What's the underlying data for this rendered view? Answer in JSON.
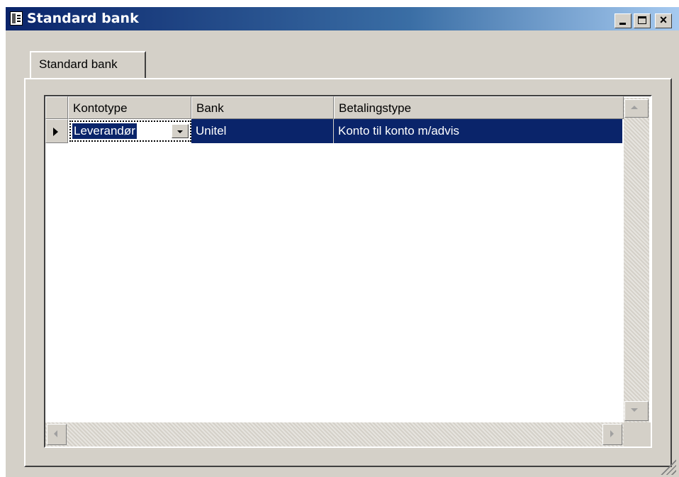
{
  "window": {
    "title": "Standard bank",
    "icon": "form-icon",
    "caption_buttons": [
      "minimize-icon",
      "maximize-icon",
      "close-icon"
    ],
    "close_glyph": "×"
  },
  "tab": {
    "label": "Standard bank"
  },
  "grid": {
    "columns": [
      "Kontotype",
      "Bank",
      "Betalingstype"
    ],
    "rows": [
      {
        "kontotype": "Leverandør",
        "bank": "Unitel",
        "betalingstype": "Konto til konto m/advis",
        "current": true,
        "selected": true
      }
    ]
  },
  "colors": {
    "titlebar_start": "#0a246a",
    "titlebar_end": "#a6caf0",
    "selection": "#0a246a",
    "face": "#d4d0c8"
  }
}
